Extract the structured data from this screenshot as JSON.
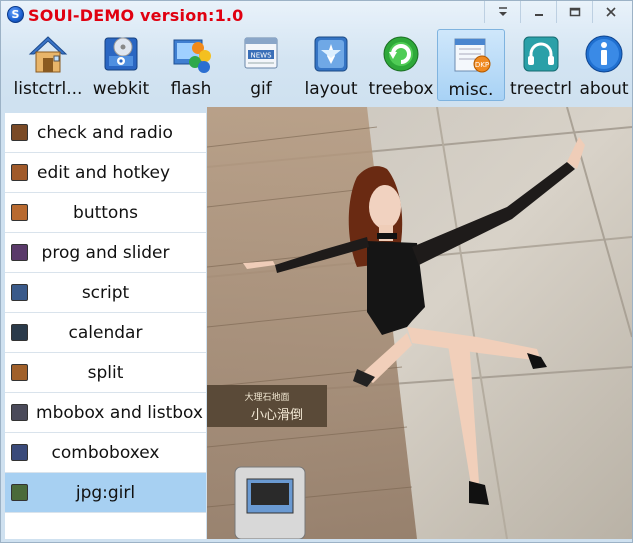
{
  "window": {
    "title": "SOUI-DEMO version:1.0",
    "logo_letter": "S"
  },
  "caption": {
    "menu_icon": "menu-arrow-icon",
    "min_icon": "minimize-icon",
    "max_icon": "maximize-icon",
    "close_icon": "close-icon"
  },
  "toolbar": {
    "items": [
      {
        "label": "listctrl...",
        "icon": "house-icon"
      },
      {
        "label": "webkit",
        "icon": "webkit-disc-icon"
      },
      {
        "label": "flash",
        "icon": "flash-icon"
      },
      {
        "label": "gif",
        "icon": "news-icon"
      },
      {
        "label": "layout",
        "icon": "layout-icon"
      },
      {
        "label": "treebox",
        "icon": "refresh-globe-icon"
      },
      {
        "label": "misc.",
        "icon": "misc-calendar-icon"
      },
      {
        "label": "treectrl",
        "icon": "headphones-icon"
      },
      {
        "label": "about",
        "icon": "info-icon"
      }
    ],
    "active_index": 6
  },
  "list": {
    "items": [
      {
        "label": "check and radio"
      },
      {
        "label": "edit and hotkey"
      },
      {
        "label": "buttons"
      },
      {
        "label": "prog and slider"
      },
      {
        "label": "script"
      },
      {
        "label": "calendar"
      },
      {
        "label": "split"
      },
      {
        "label": "mbobox and listbox"
      },
      {
        "label": "comboboxex"
      },
      {
        "label": "jpg:girl"
      }
    ],
    "selected_index": 9
  },
  "picture": {
    "sign_text": "小心滑倒",
    "sign_top_text": "大理石地面",
    "icon": "photo-image"
  },
  "colors": {
    "title_red": "#e00010",
    "selection_blue": "#a7d0f2",
    "frame_blue": "#d3e4f2"
  }
}
